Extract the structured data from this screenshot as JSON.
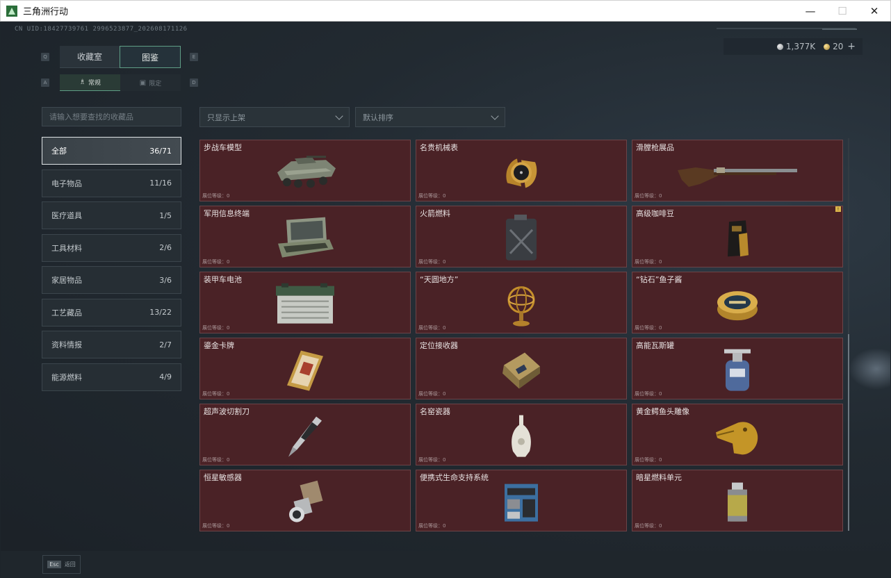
{
  "window": {
    "title": "三角洲行动",
    "controls": [
      "—",
      "☐",
      "✕"
    ]
  },
  "uid": "CN UID:18427739761 2996523877_202608171126",
  "currency": {
    "silver": "1,377K",
    "gold": "20",
    "plus": "+"
  },
  "key_hints": {
    "q": "Q",
    "e": "E",
    "a": "A",
    "d": "D"
  },
  "top_tabs": [
    {
      "label": "收藏室"
    },
    {
      "label": "图鉴"
    }
  ],
  "sub_tabs": [
    {
      "label": "常规",
      "icon": "♗"
    },
    {
      "label": "限定",
      "icon": "▣"
    }
  ],
  "search": {
    "placeholder": "请输入想要查找的收藏品"
  },
  "filters": {
    "shelf": "只显示上架",
    "sort": "默认排序"
  },
  "categories": [
    {
      "label": "全部",
      "count": "36/71"
    },
    {
      "label": "电子物品",
      "count": "11/16"
    },
    {
      "label": "医疗道具",
      "count": "1/5"
    },
    {
      "label": "工具材料",
      "count": "2/6"
    },
    {
      "label": "家居物品",
      "count": "3/6"
    },
    {
      "label": "工艺藏品",
      "count": "13/22"
    },
    {
      "label": "资料情报",
      "count": "2/7"
    },
    {
      "label": "能源燃料",
      "count": "4/9"
    }
  ],
  "level_label": "展位等级：0",
  "items": [
    {
      "name": "步战车模型",
      "icon": "apc-model-icon"
    },
    {
      "name": "名贵机械表",
      "icon": "watch-icon"
    },
    {
      "name": "滑膛枪展品",
      "icon": "musket-icon"
    },
    {
      "name": "军用信息终端",
      "icon": "terminal-icon"
    },
    {
      "name": "火箭燃料",
      "icon": "fuel-can-icon"
    },
    {
      "name": "高级咖啡豆",
      "icon": "coffee-bag-icon",
      "badge": "!"
    },
    {
      "name": "装甲车电池",
      "icon": "battery-icon"
    },
    {
      "name": "“天圆地方”",
      "icon": "armillary-icon"
    },
    {
      "name": "“钻石”鱼子酱",
      "icon": "caviar-tin-icon"
    },
    {
      "name": "鎏金卡牌",
      "icon": "gold-card-icon"
    },
    {
      "name": "定位接收器",
      "icon": "gps-receiver-icon"
    },
    {
      "name": "高能瓦斯罐",
      "icon": "gas-canister-icon"
    },
    {
      "name": "超声波切割刀",
      "icon": "cutter-icon"
    },
    {
      "name": "名窑瓷器",
      "icon": "porcelain-vase-icon"
    },
    {
      "name": "黄金鳄鱼头雕像",
      "icon": "croc-statue-icon"
    },
    {
      "name": "恒星敏感器",
      "icon": "star-sensor-icon"
    },
    {
      "name": "便携式生命支持系统",
      "icon": "life-support-icon"
    },
    {
      "name": "暗星燃料单元",
      "icon": "fuel-cell-icon"
    }
  ],
  "esc": {
    "key": "Esc",
    "label": "返回"
  }
}
